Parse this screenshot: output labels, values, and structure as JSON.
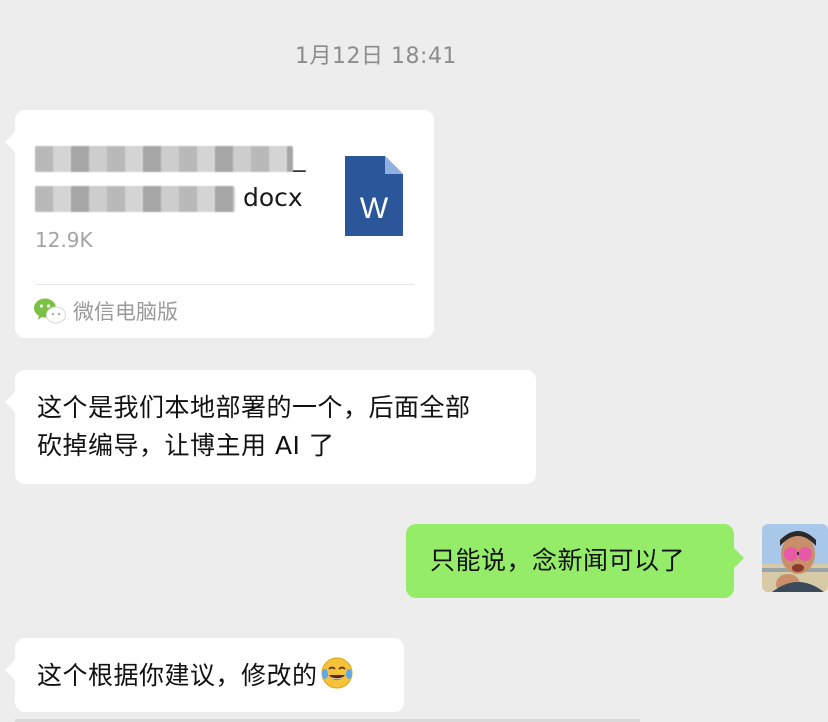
{
  "timestamp": "1月12日 18:41",
  "file_message": {
    "file_name_visible_suffix": "docx",
    "file_size": "12.9K",
    "file_icon": "word-doc-icon",
    "file_icon_letter": "W",
    "source_label": "微信电脑版",
    "source_icon": "wechat-icon"
  },
  "messages": [
    {
      "side": "left",
      "text_line1": "这个是我们本地部署的一个，后面全部",
      "text_line2": "砍掉编导，让博主用 AI 了"
    },
    {
      "side": "right",
      "text": "只能说，念新闻可以了"
    },
    {
      "side": "left",
      "text": "这个根据你建议，修改的",
      "emoji": "tears-of-joy-emoji"
    }
  ],
  "colors": {
    "background": "#ededed",
    "bubble_left": "#ffffff",
    "bubble_right": "#95ec69",
    "word_blue": "#2b579a",
    "timestamp": "#8c8c8c"
  }
}
